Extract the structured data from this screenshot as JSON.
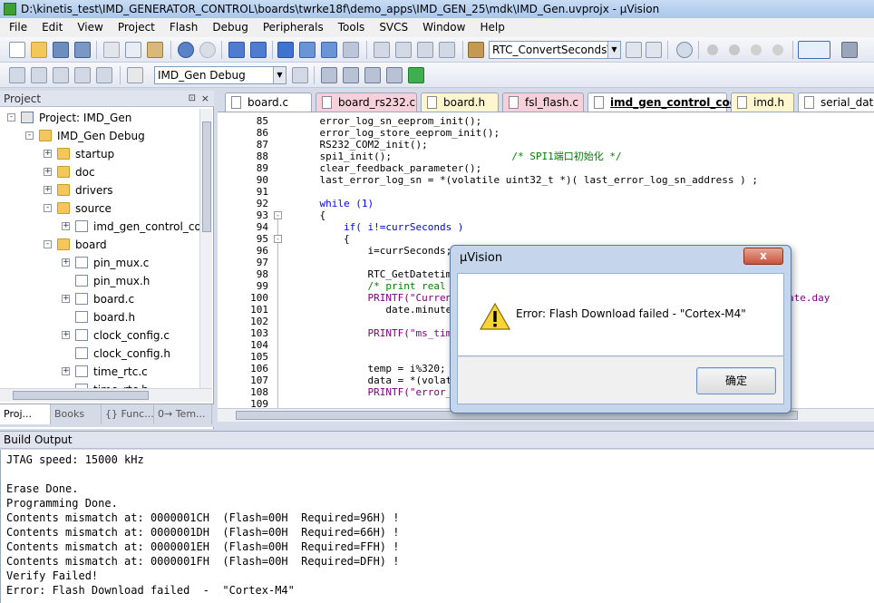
{
  "window": {
    "title": "D:\\kinetis_test\\IMD_GENERATOR_CONTROL\\boards\\twrke18f\\demo_apps\\IMD_GEN_25\\mdk\\IMD_Gen.uvprojx - µVision"
  },
  "menu": [
    "File",
    "Edit",
    "View",
    "Project",
    "Flash",
    "Debug",
    "Peripherals",
    "Tools",
    "SVCS",
    "Window",
    "Help"
  ],
  "toolbar": {
    "function_combo": "RTC_ConvertSecondsToD",
    "target_combo": "IMD_Gen Debug"
  },
  "colors": {
    "accent": "#3399ff",
    "keyword": "#0000ff",
    "comment": "#008000",
    "string": "#800080",
    "tab_c": "#ffffff",
    "tab_h": "#fff6cf",
    "tab_pink": "#f6d1dc"
  },
  "project": {
    "title": "Project",
    "pin": "⊡",
    "close": "×",
    "tree": [
      {
        "label": "Project: IMD_Gen",
        "indent": 0,
        "icon": "project",
        "exp": "-"
      },
      {
        "label": "IMD_Gen Debug",
        "indent": 1,
        "icon": "folder",
        "exp": "-"
      },
      {
        "label": "startup",
        "indent": 2,
        "icon": "folder",
        "exp": "+"
      },
      {
        "label": "doc",
        "indent": 2,
        "icon": "folder",
        "exp": "+"
      },
      {
        "label": "drivers",
        "indent": 2,
        "icon": "folder",
        "exp": "+"
      },
      {
        "label": "source",
        "indent": 2,
        "icon": "folder",
        "exp": "-"
      },
      {
        "label": "imd_gen_control_co",
        "indent": 3,
        "icon": "file",
        "exp": "+"
      },
      {
        "label": "board",
        "indent": 2,
        "icon": "folder",
        "exp": "-"
      },
      {
        "label": "pin_mux.c",
        "indent": 3,
        "icon": "file",
        "exp": "+"
      },
      {
        "label": "pin_mux.h",
        "indent": 3,
        "icon": "file",
        "exp": ""
      },
      {
        "label": "board.c",
        "indent": 3,
        "icon": "file",
        "exp": "+"
      },
      {
        "label": "board.h",
        "indent": 3,
        "icon": "file",
        "exp": ""
      },
      {
        "label": "clock_config.c",
        "indent": 3,
        "icon": "file",
        "exp": "+"
      },
      {
        "label": "clock_config.h",
        "indent": 3,
        "icon": "file",
        "exp": ""
      },
      {
        "label": "time_rtc.c",
        "indent": 3,
        "icon": "file",
        "exp": "+"
      },
      {
        "label": "time_rtc.h",
        "indent": 3,
        "icon": "file",
        "exp": ""
      }
    ],
    "tabs": [
      "Proj...",
      "Books",
      "{} Func...",
      "0→ Tem..."
    ]
  },
  "editor": {
    "tabs": [
      {
        "label": "board.c",
        "type": "c"
      },
      {
        "label": "board_rs232.c",
        "type": "pink"
      },
      {
        "label": "board.h",
        "type": "h"
      },
      {
        "label": "fsl_flash.c",
        "type": "pink"
      },
      {
        "label": "imd_gen_control_code.c",
        "type": "active"
      },
      {
        "label": "imd.h",
        "type": "h"
      },
      {
        "label": "serial_data_p",
        "type": "c"
      }
    ],
    "lines": [
      {
        "n": "85",
        "code": "    error_log_sn_eeprom_init();"
      },
      {
        "n": "86",
        "code": "    error_log_store_eeprom_init();"
      },
      {
        "n": "87",
        "code": "    RS232_COM2_init();"
      },
      {
        "n": "88",
        "code": "    spi1_init();                    ",
        "comment": "/* SPI1端口初始化 */"
      },
      {
        "n": "89",
        "code": "    clear_feedback_parameter();"
      },
      {
        "n": "90",
        "code": "    last_error_log_sn = *(volatile uint32_t *)( last_error_log_sn_address ) ;"
      },
      {
        "n": "91",
        "code": ""
      },
      {
        "n": "92",
        "code": "    while (1)",
        "kw": "while"
      },
      {
        "n": "93",
        "code": "    {",
        "fold": "-"
      },
      {
        "n": "94",
        "code": "        if( i!=currSeconds )",
        "kw": "if"
      },
      {
        "n": "95",
        "code": "        {",
        "fold": "-"
      },
      {
        "n": "96",
        "code": "            i=currSeconds;"
      },
      {
        "n": "97",
        "code": ""
      },
      {
        "n": "98",
        "code": "            RTC_GetDatetim"
      },
      {
        "n": "99",
        "code": "            ",
        "comment": "/* print real"
      },
      {
        "n": "100",
        "code": "            PRINTF(\"Curren                                                 onth, date.day"
      },
      {
        "n": "101",
        "code": "               date.minute"
      },
      {
        "n": "102",
        "code": ""
      },
      {
        "n": "103",
        "code": "            PRINTF(\"ms_tim"
      },
      {
        "n": "104",
        "code": ""
      },
      {
        "n": "105",
        "code": ""
      },
      {
        "n": "106",
        "code": "            temp = i%320;"
      },
      {
        "n": "107",
        "code": "            data = *(volat                                              ) ;"
      },
      {
        "n": "108",
        "code": "            PRINTF(\"error_"
      },
      {
        "n": "109",
        "code": ""
      }
    ]
  },
  "build": {
    "title": "Build Output",
    "lines": [
      "JTAG speed: 15000 kHz",
      "",
      "Erase Done.",
      "Programming Done.",
      "Contents mismatch at: 0000001CH  (Flash=00H  Required=96H) !",
      "Contents mismatch at: 0000001DH  (Flash=00H  Required=66H) !",
      "Contents mismatch at: 0000001EH  (Flash=00H  Required=FFH) !",
      "Contents mismatch at: 0000001FH  (Flash=00H  Required=DFH) !",
      "Verify Failed!",
      "Error: Flash Download failed  -  \"Cortex-M4\""
    ]
  },
  "dialog": {
    "title": "µVision",
    "close": "x",
    "message": "Error: Flash Download failed  -  \"Cortex-M4\"",
    "ok_label": "确定"
  }
}
